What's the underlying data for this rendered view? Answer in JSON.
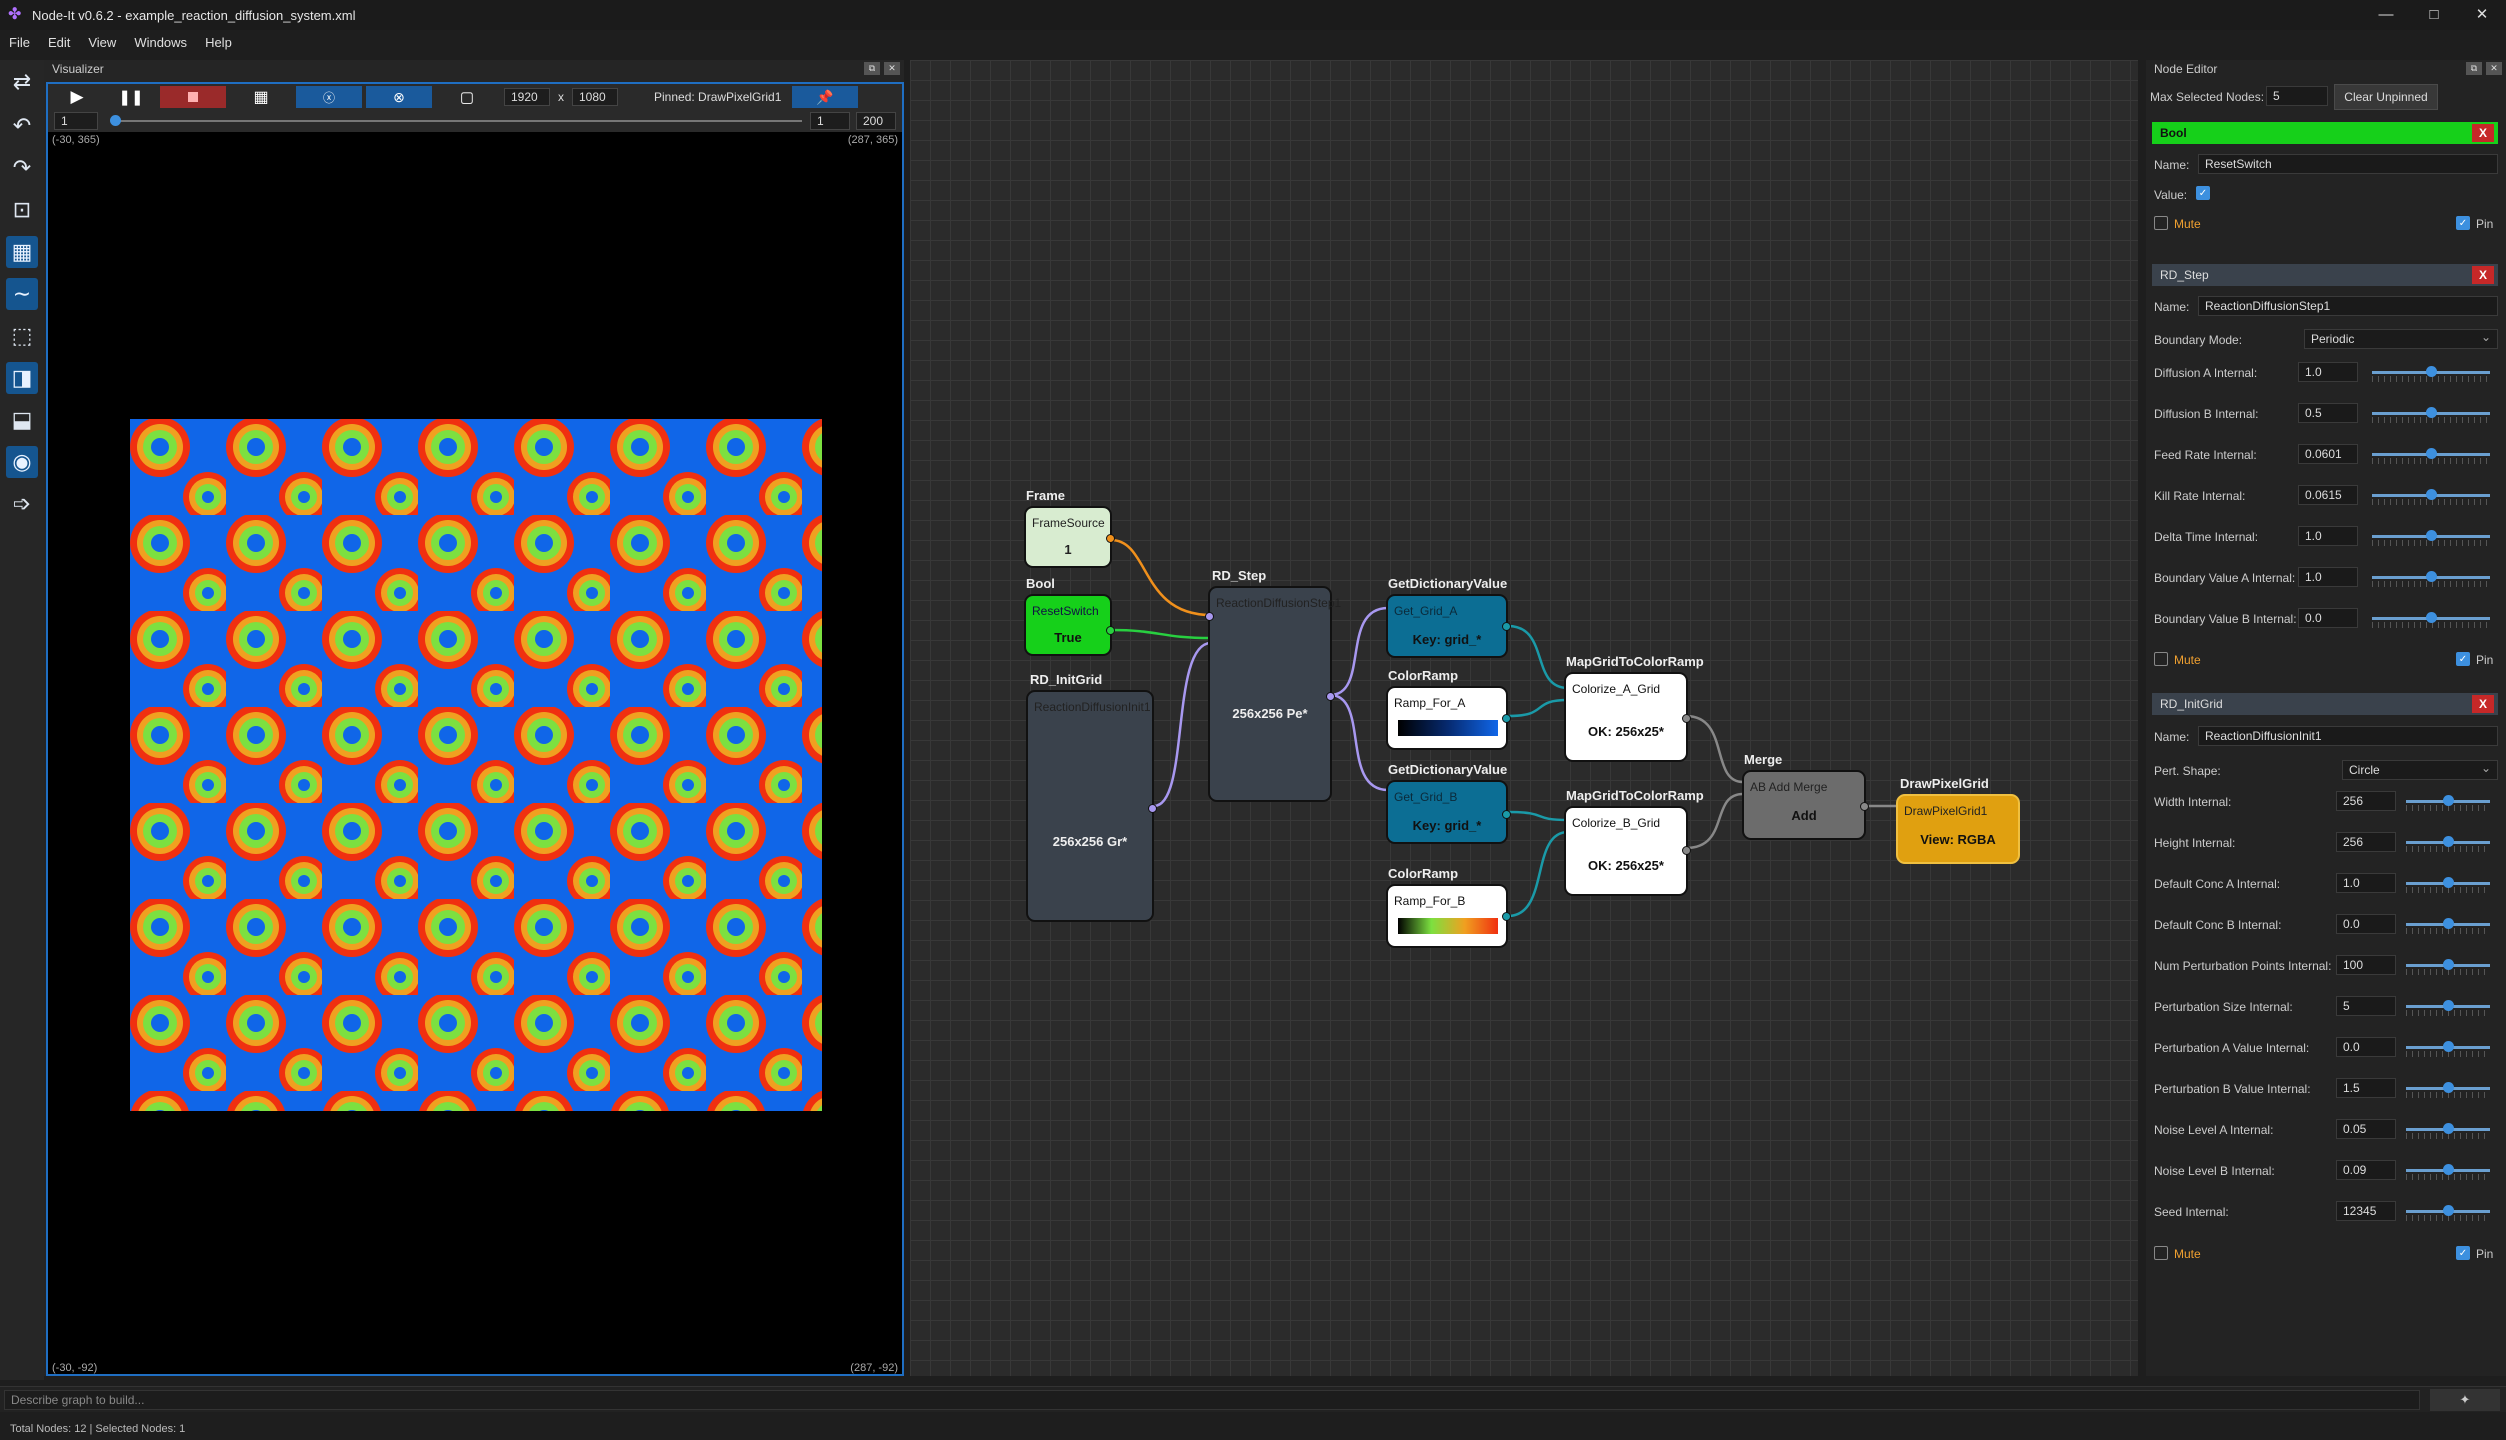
{
  "window": {
    "title": "Node-It v0.6.2 - example_reaction_diffusion_system.xml",
    "controls": [
      "—",
      "□",
      "✕"
    ]
  },
  "menu": [
    "File",
    "Edit",
    "View",
    "Windows",
    "Help"
  ],
  "visualizer": {
    "title": "Visualizer",
    "width": "1920",
    "height": "1080",
    "x_sep": "x",
    "pinned": "Pinned: DrawPixelGrid1",
    "frame_start": "1",
    "frame_current": "1",
    "frame_end": "200",
    "coords": {
      "top_left": "(-30, 365)",
      "top_right": "(287, 365)",
      "bottom_left": "(-30, -92)",
      "bottom_right": "(287, -92)"
    },
    "colors": {
      "background": "#1066e8",
      "ring_outer": "#f03010",
      "ring_mid": "#f0a020",
      "ring_inner": "#7ce040"
    }
  },
  "graph": {
    "nodes": {
      "frame": {
        "title": "Frame",
        "sub": "FrameSource",
        "value": "1"
      },
      "bool": {
        "title": "Bool",
        "sub": "ResetSwitch",
        "value": "True"
      },
      "rd_init": {
        "title": "RD_InitGrid",
        "sub": "ReactionDiffusionInit1",
        "value": "256x256 Gr*"
      },
      "rd_step": {
        "title": "RD_Step",
        "sub": "ReactionDiffusionStep1",
        "value": "256x256 Pe*"
      },
      "getdict_a": {
        "title": "GetDictionaryValue",
        "sub": "Get_Grid_A",
        "value": "Key: grid_*"
      },
      "getdict_b": {
        "title": "GetDictionaryValue",
        "sub": "Get_Grid_B",
        "value": "Key: grid_*"
      },
      "ramp_a": {
        "title": "ColorRamp",
        "sub": "Ramp_For_A"
      },
      "ramp_b": {
        "title": "ColorRamp",
        "sub": "Ramp_For_B"
      },
      "map_a": {
        "title": "MapGridToColorRamp",
        "sub": "Colorize_A_Grid",
        "value": "OK: 256x25*"
      },
      "map_b": {
        "title": "MapGridToColorRamp",
        "sub": "Colorize_B_Grid",
        "value": "OK: 256x25*"
      },
      "merge": {
        "title": "Merge",
        "sub": "AB Add Merge",
        "value": "Add"
      },
      "draw": {
        "title": "DrawPixelGrid",
        "sub": "DrawPixelGrid1",
        "value": "View: RGBA"
      }
    }
  },
  "editor": {
    "title": "Node Editor",
    "max_label": "Max Selected Nodes:",
    "max_value": "5",
    "clear_btn": "Clear Unpinned",
    "bool_section": {
      "header": "Bool",
      "name_label": "Name:",
      "name": "ResetSwitch",
      "value_label": "Value:",
      "mute": "Mute",
      "pin": "Pin"
    },
    "step_section": {
      "header": "RD_Step",
      "name_label": "Name:",
      "name": "ReactionDiffusionStep1",
      "boundary_label": "Boundary Mode:",
      "boundary": "Periodic",
      "params": [
        {
          "label": "Diffusion A Internal:",
          "value": "1.0",
          "level": 0.5
        },
        {
          "label": "Diffusion B Internal:",
          "value": "0.5",
          "level": 0.5
        },
        {
          "label": "Feed Rate Internal:",
          "value": "0.0601",
          "level": 0.5
        },
        {
          "label": "Kill Rate Internal:",
          "value": "0.0615",
          "level": 0.5
        },
        {
          "label": "Delta Time Internal:",
          "value": "1.0",
          "level": 0.5
        },
        {
          "label": "Boundary Value A Internal:",
          "value": "1.0",
          "level": 0.5
        },
        {
          "label": "Boundary Value B Internal:",
          "value": "0.0",
          "level": 0.5
        }
      ],
      "mute": "Mute",
      "pin": "Pin"
    },
    "init_section": {
      "header": "RD_InitGrid",
      "name_label": "Name:",
      "name": "ReactionDiffusionInit1",
      "shape_label": "Pert. Shape:",
      "shape": "Circle",
      "params": [
        {
          "label": "Width Internal:",
          "value": "256",
          "level": 0.5
        },
        {
          "label": "Height Internal:",
          "value": "256",
          "level": 0.5
        },
        {
          "label": "Default Conc A Internal:",
          "value": "1.0",
          "level": 0.5
        },
        {
          "label": "Default Conc B Internal:",
          "value": "0.0",
          "level": 0.5
        },
        {
          "label": "Num Perturbation Points Internal:",
          "value": "100",
          "level": 0.5
        },
        {
          "label": "Perturbation Size Internal:",
          "value": "5",
          "level": 0.5
        },
        {
          "label": "Perturbation A Value Internal:",
          "value": "0.0",
          "level": 0.5
        },
        {
          "label": "Perturbation B Value Internal:",
          "value": "1.5",
          "level": 0.5
        },
        {
          "label": "Noise Level A Internal:",
          "value": "0.05",
          "level": 0.5
        },
        {
          "label": "Noise Level B Internal:",
          "value": "0.09",
          "level": 0.5
        },
        {
          "label": "Seed Internal:",
          "value": "12345",
          "level": 0.5
        }
      ],
      "mute": "Mute",
      "pin": "Pin"
    }
  },
  "prompt": {
    "placeholder": "Describe graph to build..."
  },
  "status": "Total Nodes: 12 | Selected Nodes: 1"
}
